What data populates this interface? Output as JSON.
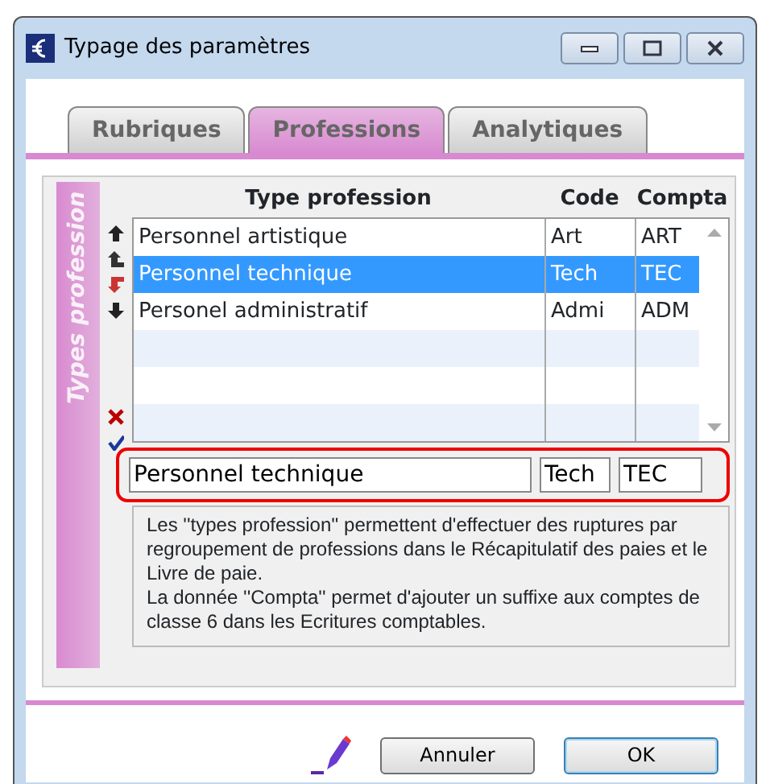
{
  "window": {
    "title": "Typage des paramètres"
  },
  "tabs": [
    {
      "label": "Rubriques",
      "selected": false
    },
    {
      "label": "Professions",
      "selected": true
    },
    {
      "label": "Analytiques",
      "selected": false
    }
  ],
  "sidebar": {
    "label": "Types profession"
  },
  "table": {
    "columns": [
      "Type profession",
      "Code",
      "Compta"
    ],
    "rows": [
      {
        "cells": [
          "Personnel artistique",
          "Art",
          "ART"
        ],
        "selected": false
      },
      {
        "cells": [
          "Personnel technique",
          "Tech",
          "TEC"
        ],
        "selected": true
      },
      {
        "cells": [
          "Personel administratif",
          "Admi",
          "ADM"
        ],
        "selected": false
      }
    ]
  },
  "edit_row": {
    "type_profession": "Personnel technique",
    "code": "Tech",
    "compta": "TEC"
  },
  "description": [
    "Les ''types profession'' permettent d'effectuer des ruptures par regroupement de professions dans le Récapitulatif des paies et le Livre de paie.",
    "La donnée ''Compta'' permet d'ajouter un suffixe aux comptes de classe 6 dans les Ecritures comptables."
  ],
  "buttons": [
    {
      "label": "Annuler",
      "default": false
    },
    {
      "label": "OK",
      "default": true
    }
  ]
}
